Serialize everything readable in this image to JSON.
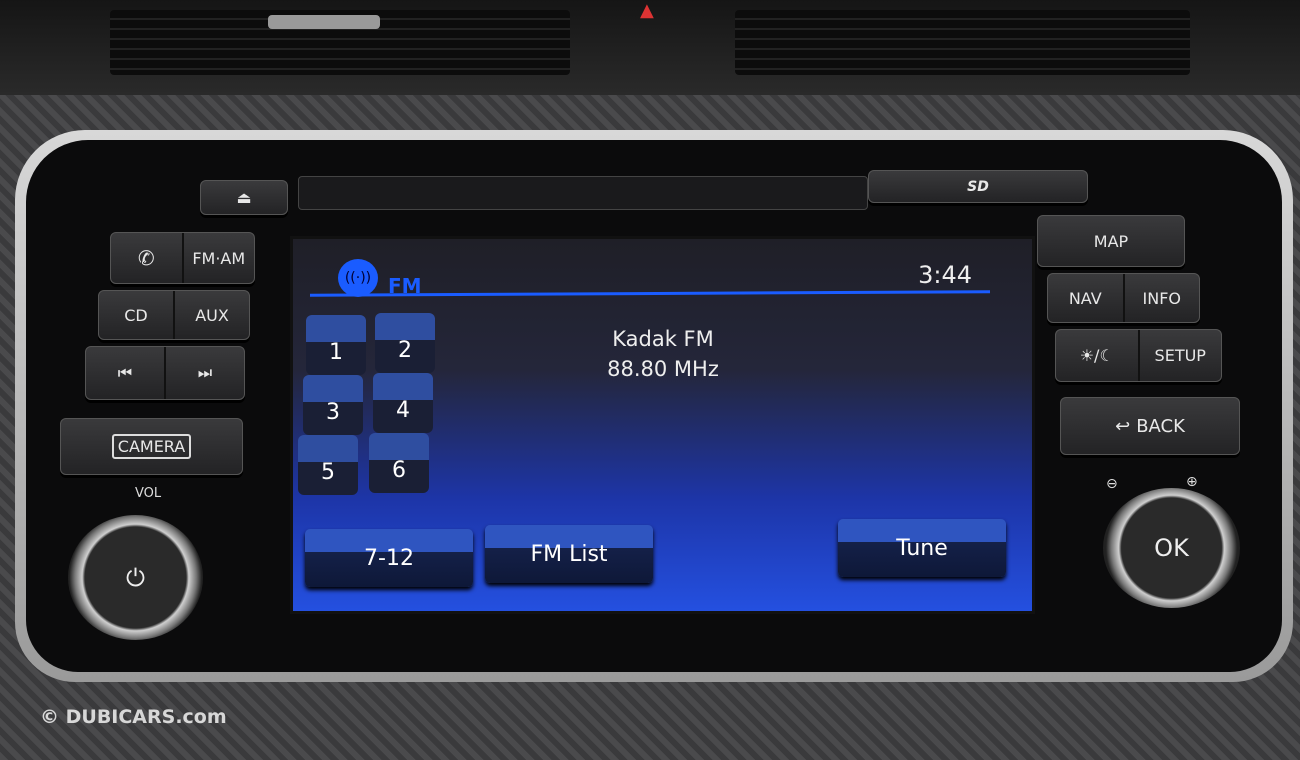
{
  "left_panel": {
    "fm_am": "FM·AM",
    "cd": "CD",
    "aux": "AUX",
    "prev_icon": "⏮",
    "next_icon": "⏭",
    "camera": "CAMERA",
    "vol": "VOL",
    "phone_icon": "✆",
    "power_icon": "⏻",
    "eject_icon": "⏏"
  },
  "right_panel": {
    "map": "MAP",
    "nav": "NAV",
    "info": "INFO",
    "day_night": "☀/☾",
    "setup": "SETUP",
    "back": "BACK",
    "back_icon": "↩",
    "ok": "OK",
    "zoom_out_icon": "⊖",
    "zoom_in_icon": "⊕"
  },
  "sd_label": "SD",
  "screen": {
    "source": "FM",
    "time": "3:44",
    "station": "Kadak FM",
    "frequency": "88.80 MHz",
    "presets": [
      "1",
      "2",
      "3",
      "4",
      "5",
      "6"
    ],
    "buttons": {
      "next_bank": "7-12",
      "list": "FM List",
      "tune": "Tune"
    },
    "accent": "#1a5cff"
  },
  "watermark": "© DUBICARS.com"
}
